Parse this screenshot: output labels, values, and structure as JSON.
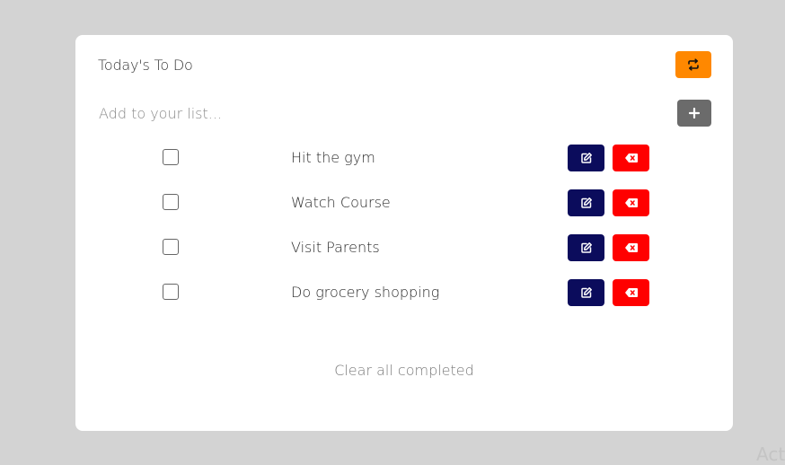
{
  "header": {
    "title": "Today's To Do",
    "refresh_icon": "refresh-arrows-icon"
  },
  "add_form": {
    "placeholder": "Add to your list...",
    "value": "",
    "add_icon": "plus-icon"
  },
  "todos": [
    {
      "text": "Hit the gym",
      "checked": false
    },
    {
      "text": "Watch Course",
      "checked": false
    },
    {
      "text": "Visit Parents",
      "checked": false
    },
    {
      "text": "Do grocery shopping",
      "checked": false
    }
  ],
  "footer": {
    "clear_label": "Clear all completed"
  },
  "watermark": "Acti",
  "colors": {
    "background": "#d3d3d3",
    "card": "#ffffff",
    "refresh_button": "#ff8800",
    "add_button": "#6b6b6b",
    "edit_button": "#0b0c5c",
    "delete_button": "#ff0000"
  }
}
